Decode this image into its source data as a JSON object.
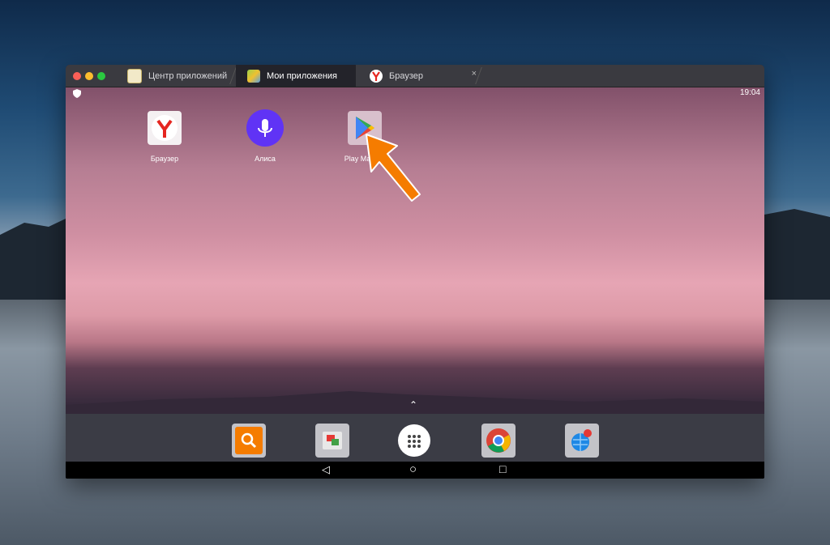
{
  "window": {
    "tabs": [
      {
        "label": "Центр приложений",
        "icon": "app-center-icon",
        "active": false
      },
      {
        "label": "Мои приложения",
        "icon": "bluestacks-icon",
        "active": true
      },
      {
        "label": "Браузер",
        "icon": "yandex-browser-icon",
        "active": false,
        "close": "×"
      }
    ]
  },
  "android": {
    "status": {
      "time": "19:04",
      "left_icon": "shield-icon"
    },
    "apps": [
      {
        "label": "Браузер",
        "icon": "yandex-browser-icon"
      },
      {
        "label": "Алиса",
        "icon": "alice-mic-icon"
      },
      {
        "label": "Play Маркет",
        "icon": "play-store-icon"
      }
    ],
    "dock": [
      "search-app-icon",
      "gallery-app-icon",
      "app-drawer-icon",
      "chrome-icon",
      "world-map-icon"
    ],
    "nav": {
      "back": "◁",
      "home": "○",
      "recents": "□"
    },
    "drawer_hint": "⌃"
  },
  "colors": {
    "accent_arrow": "#f57c00",
    "yandex_red": "#e52620",
    "alice_purple": "#6033f5"
  }
}
